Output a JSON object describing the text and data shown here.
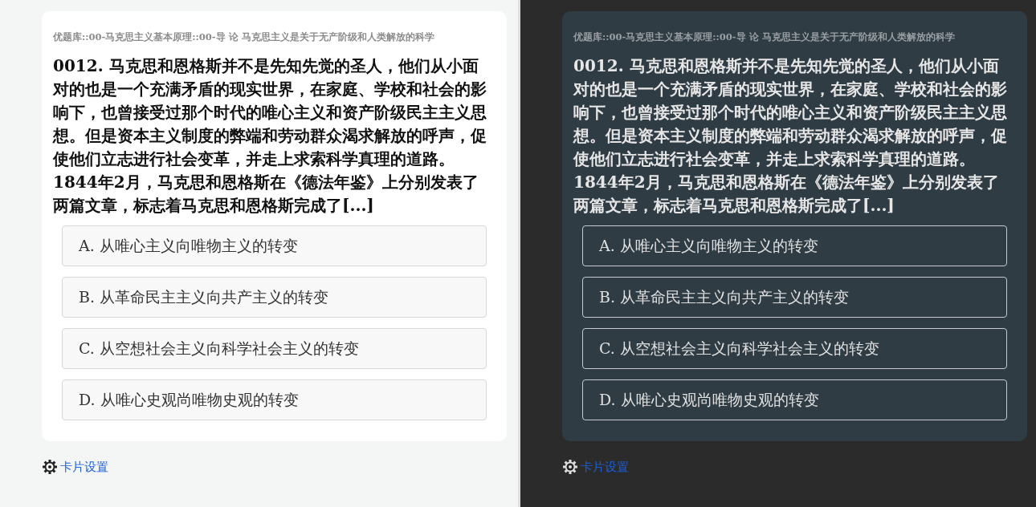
{
  "panels": [
    {
      "kind": "light",
      "breadcrumb": "优题库::00-马克思主义基本原理::00-导 论 马克思主义是关于无产阶级和人类解放的科学",
      "question": "0012. 马克思和恩格斯并不是先知先觉的圣人，他们从小面对的也是一个充满矛盾的现实世界，在家庭、学校和社会的影响下，也曾接受过那个时代的唯心主义和资产阶级民主主义思想。但是资本主义制度的弊端和劳动群众渴求解放的呼声，促使他们立志进行社会变革，并走上求索科学真理的道路。1844年2月，马克思和恩格斯在《德法年鉴》上分别发表了两篇文章，标志着马克思和恩格斯完成了[...]",
      "options": [
        "A. 从唯心主义向唯物主义的转变",
        "B. 从革命民主主义向共产主义的转变",
        "C. 从空想社会主义向科学社会主义的转变",
        "D. 从唯心史观尚唯物史观的转变"
      ],
      "settings_link": "卡片设置"
    },
    {
      "kind": "dark",
      "breadcrumb": "优题库::00-马克思主义基本原理::00-导 论 马克思主义是关于无产阶级和人类解放的科学",
      "question": "0012. 马克思和恩格斯并不是先知先觉的圣人，他们从小面对的也是一个充满矛盾的现实世界，在家庭、学校和社会的影响下，也曾接受过那个时代的唯心主义和资产阶级民主主义思想。但是资本主义制度的弊端和劳动群众渴求解放的呼声，促使他们立志进行社会变革，并走上求索科学真理的道路。1844年2月，马克思和恩格斯在《德法年鉴》上分别发表了两篇文章，标志着马克思和恩格斯完成了[...]",
      "options": [
        "A. 从唯心主义向唯物主义的转变",
        "B. 从革命民主主义向共产主义的转变",
        "C. 从空想社会主义向科学社会主义的转变",
        "D. 从唯心史观尚唯物史观的转变"
      ],
      "settings_link": "卡片设置"
    }
  ]
}
